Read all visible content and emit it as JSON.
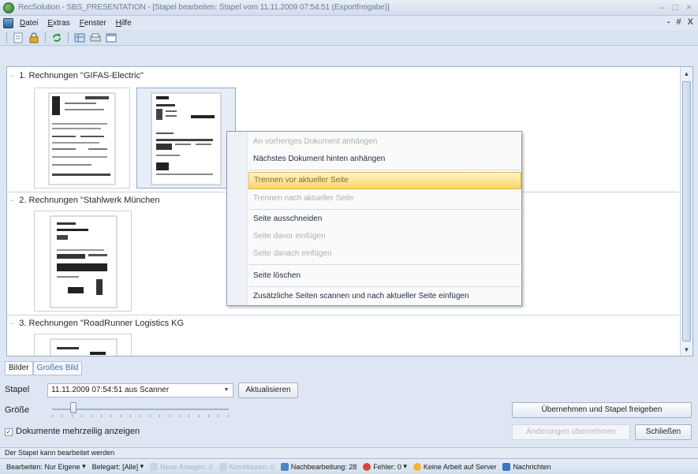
{
  "window": {
    "title": "RecSolution - SBS_PRESENTATION - [Stapel bearbeiten: Stapel vom 11.11.2009 07:54:51 (Exportfreigabe)]",
    "controls": [
      "–",
      "□",
      "×"
    ]
  },
  "menu": {
    "items": [
      "Datei",
      "Extras",
      "Fenster",
      "Hilfe"
    ],
    "mdi_controls": [
      "-",
      "#",
      "X"
    ]
  },
  "toolbar": {
    "icons": [
      "page-icon",
      "lock-icon",
      "refresh-icon",
      "grid-icon",
      "scan-icon",
      "window-icon"
    ]
  },
  "groups": [
    {
      "label": "1. Rechnungen \"GIFAS-Electric\""
    },
    {
      "label": "2. Rechnungen \"Stahlwerk München"
    },
    {
      "label": "3. Rechnungen \"RoadRunner Logistics KG"
    }
  ],
  "context_menu": {
    "items": [
      {
        "label": "An vorheriges Dokument anhängen",
        "state": "disabled"
      },
      {
        "label": "Nächstes Dokument hinten anhängen",
        "state": "enabled"
      },
      {
        "label": "Trennen vor aktueller Seite",
        "state": "highlighted"
      },
      {
        "label": "Trennen nach aktueller Seite",
        "state": "disabled"
      },
      {
        "label": "Seite ausschneiden",
        "state": "enabled"
      },
      {
        "label": "Seite davor einfügen",
        "state": "disabled"
      },
      {
        "label": "Seite danach einfügen",
        "state": "disabled"
      },
      {
        "label": "Seite löschen",
        "state": "enabled"
      },
      {
        "label": "Zusätzliche Seiten scannen und nach aktueller Seite einfügen",
        "state": "enabled"
      }
    ]
  },
  "tabs": {
    "bilder": "Bilder",
    "grosses_bild": "Großes Bild",
    "active": "grosses_bild"
  },
  "controls": {
    "stapel_label": "Stapel",
    "stapel_value": "11.11.2009 07:54:51 aus Scanner",
    "refresh_button": "Aktualisieren",
    "groesse_label": "Größe",
    "slider_value_fraction": 0.12,
    "checkbox_label": "Dokumente mehrzeilig anzeigen",
    "checkbox_checked": true,
    "accept_release_button": "Übernehmen und Stapel freigeben",
    "apply_changes_button": "Änderungen übernehmen",
    "close_button": "Schließen"
  },
  "status": {
    "message": "Der Stapel kann bearbeitet werden",
    "bearbeiten": "Bearbeiten: Nur Eigene",
    "belegart": "Belegart: [Alle]",
    "neue_anlagen": "Neue Anlagen: 0",
    "korrekturen": "Korrekturen: 0",
    "nachbearbeitung": "Nachbearbeitung: 28",
    "fehler": "Fehler: 0",
    "server": "Keine Arbeit auf Server",
    "nachrichten": "Nachrichten"
  },
  "colors": {
    "highlight": "#fcd66a",
    "link_blue": "#3b6fb3",
    "panel_bg": "#dde6f2"
  }
}
